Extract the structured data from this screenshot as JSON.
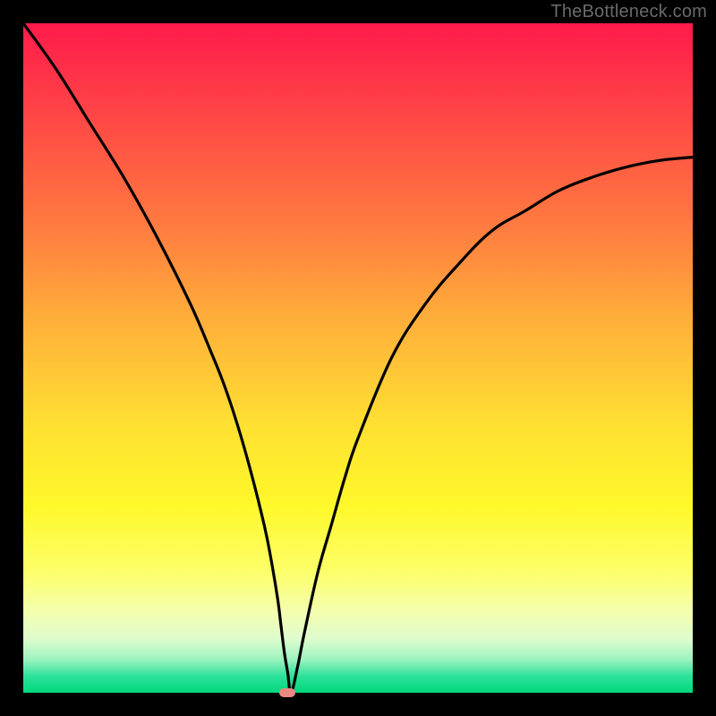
{
  "watermark": "TheBottleneck.com",
  "colors": {
    "frame": "#000000",
    "curve": "#000000",
    "marker": "#e98a82",
    "gradient_top": "#ff1a4b",
    "gradient_bottom": "#00d77d"
  },
  "chart_data": {
    "type": "line",
    "title": "",
    "xlabel": "",
    "ylabel": "",
    "xlim": [
      0,
      100
    ],
    "ylim": [
      0,
      100
    ],
    "x": [
      0,
      5,
      10,
      15,
      20,
      25,
      28,
      30,
      32,
      34,
      36,
      37,
      38,
      38.5,
      39,
      39.5,
      40,
      41,
      42,
      44,
      46,
      48,
      50,
      55,
      60,
      65,
      70,
      75,
      80,
      85,
      90,
      95,
      100
    ],
    "values": [
      100,
      93,
      85,
      77,
      68,
      58,
      51,
      46,
      40,
      33,
      25,
      20,
      14,
      10,
      6,
      3,
      0,
      4,
      9,
      18,
      25,
      32,
      38,
      50,
      58,
      64,
      69,
      72,
      75,
      77,
      78.5,
      79.5,
      80
    ],
    "marker": {
      "x": 39.5,
      "y": 0
    },
    "notes": "V-shaped bottleneck curve over vertical red-to-green gradient; axes unlabeled; values estimated from pixel positions."
  }
}
